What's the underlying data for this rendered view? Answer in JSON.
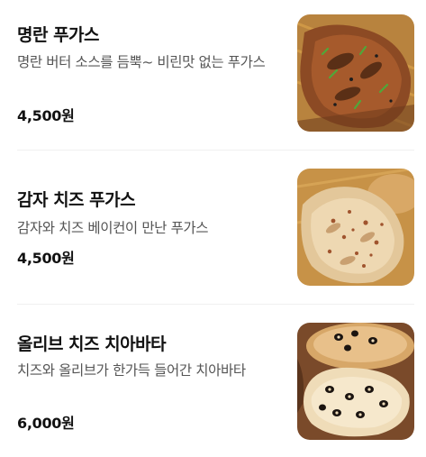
{
  "menu": {
    "items": [
      {
        "name": "명란 푸가스",
        "description": "명란 버터 소스를 듬뿍~ 비린맛 없는 푸가스",
        "price": "4,500원",
        "image": "mentaiko-fougasse-photo"
      },
      {
        "name": "감자 치즈 푸가스",
        "description": "감자와 치즈 베이컨이 만난 푸가스",
        "price": "4,500원",
        "image": "potato-cheese-fougasse-photo"
      },
      {
        "name": "올리브 치즈 치아바타",
        "description": "치즈와 올리브가 한가득 들어간 치아바타",
        "price": "6,000원",
        "image": "olive-cheese-ciabatta-photo"
      }
    ]
  }
}
